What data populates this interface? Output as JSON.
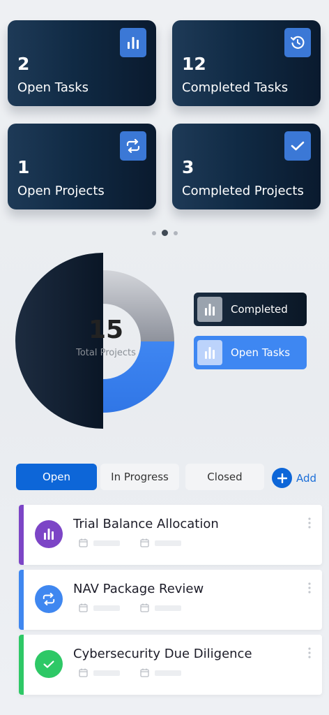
{
  "stats": [
    {
      "value": "2",
      "label": "Open Tasks",
      "icon": "bar-chart-icon"
    },
    {
      "value": "12",
      "label": "Completed Tasks",
      "icon": "history-icon"
    },
    {
      "value": "1",
      "label": "Open Projects",
      "icon": "repeat-icon"
    },
    {
      "value": "3",
      "label": "Completed Projects",
      "icon": "check-icon"
    }
  ],
  "pager": {
    "count": 3,
    "active_index": 1
  },
  "chart_data": {
    "type": "pie",
    "center_value": "15",
    "center_label": "Total Projects",
    "legend": [
      {
        "label": "Completed",
        "color": "#9aa3ae"
      },
      {
        "label": "Open Tasks",
        "color": "#3e87f2"
      }
    ]
  },
  "tabs": [
    {
      "label": "Open",
      "active": true
    },
    {
      "label": "In Progress",
      "active": false
    },
    {
      "label": "Closed",
      "active": false
    }
  ],
  "add_label": "Add",
  "tasks": [
    {
      "title": "Trial Balance Allocation",
      "accent": "#7c45c6",
      "icon": "bar-chart-icon"
    },
    {
      "title": "NAV Package Review",
      "accent": "#3f87f0",
      "icon": "repeat-icon"
    },
    {
      "title": "Cybersecurity Due Diligence",
      "accent": "#2ec866",
      "icon": "check-icon"
    }
  ],
  "colors": {
    "primary": "#0d66d8",
    "card_dark": "#0a1a2e"
  }
}
